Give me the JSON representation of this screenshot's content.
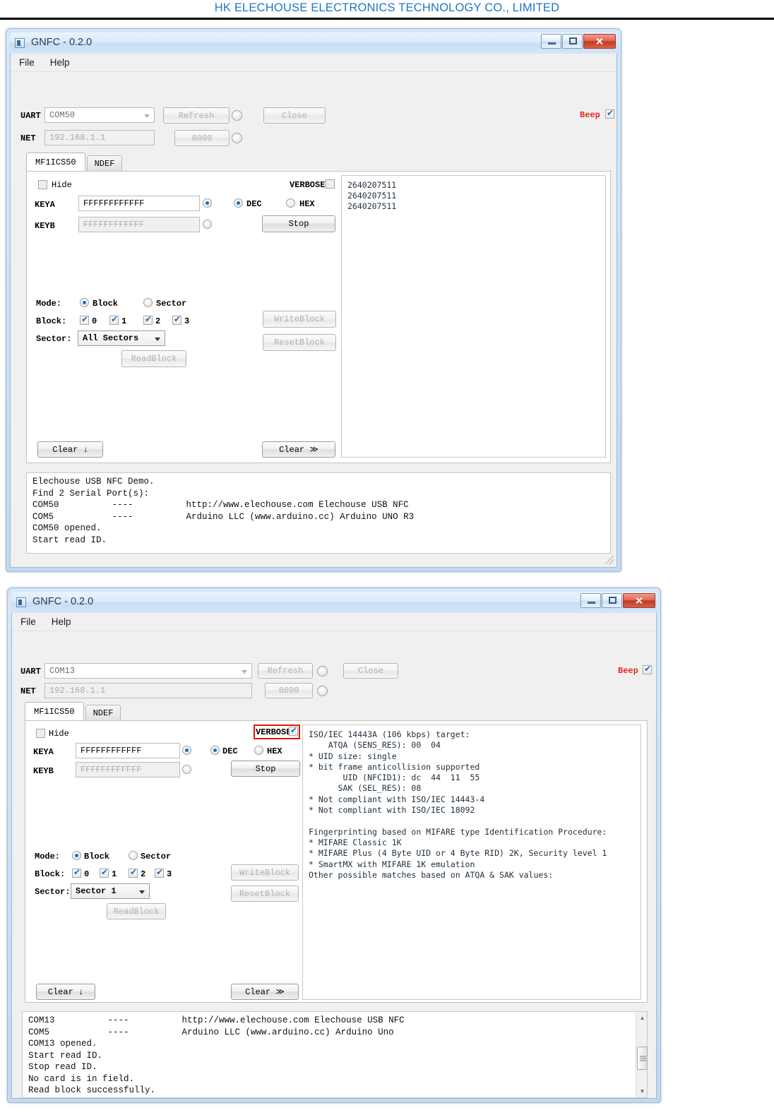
{
  "page": {
    "header": "HK ELECHOUSE ELECTRONICS TECHNOLOGY CO., LIMITED",
    "header_color": "#1f76c4"
  },
  "windows": [
    {
      "title": "GNFC - 0.2.0",
      "title_icon": "app-icon",
      "buttons": {
        "minimize": "–",
        "maximize": "□",
        "close": "✕"
      },
      "menu": [
        "File",
        "Help"
      ],
      "connection": {
        "uart_label": "UART",
        "uart_value": "COM50",
        "refresh_label": "Refresh",
        "close_label": "Close",
        "net_label": "NET",
        "net_value": "192.168.1.1",
        "port_value": "8000",
        "beep_label": "Beep",
        "beep_checked": true,
        "uart_radio_selected": false,
        "net_radio_selected": false
      },
      "tabs": [
        {
          "label": "MF1ICS50",
          "selected": true
        },
        {
          "label": "NDEF",
          "selected": false
        }
      ],
      "keys": {
        "hide_label": "Hide",
        "hide_checked": false,
        "keya_label": "KEYA",
        "keya_value": "FFFFFFFFFFFF",
        "keya_selected": true,
        "keyb_label": "KEYB",
        "keyb_value": "FFFFFFFFFFFF",
        "keyb_selected": false
      },
      "format": {
        "verbose_label": "VERBOSE",
        "verbose_checked": false,
        "dec_label": "DEC",
        "dec_selected": true,
        "hex_label": "HEX",
        "hex_selected": false,
        "stop_label": "Stop"
      },
      "mode": {
        "mode_label": "Mode:",
        "block_radio_label": "Block",
        "block_radio_selected": true,
        "sector_radio_label": "Sector",
        "sector_radio_selected": false,
        "block_label": "Block:",
        "block_checks": [
          {
            "label": "0",
            "checked": true
          },
          {
            "label": "1",
            "checked": true
          },
          {
            "label": "2",
            "checked": true
          },
          {
            "label": "3",
            "checked": true
          }
        ],
        "sector_label": "Sector:",
        "sector_value": "All Sectors",
        "read_block_label": "ReadBlock",
        "write_block_label": "WriteBlock",
        "reset_block_label": "ResetBlock"
      },
      "clear_left_label": "Clear  ↓",
      "clear_right_label": "Clear  ≫",
      "output": "2640207511\n2640207511\n2640207511",
      "log": "Elechouse USB NFC Demo.\nFind 2 Serial Port(s):\nCOM50          ----          http://www.elechouse.com Elechouse USB NFC\nCOM5           ----          Arduino LLC (www.arduino.cc) Arduino UNO R3\nCOM50 opened.\nStart read ID."
    },
    {
      "title": "GNFC - 0.2.0",
      "title_icon": "app-icon",
      "buttons": {
        "minimize": "–",
        "maximize": "□",
        "close": "✕"
      },
      "menu": [
        "File",
        "Help"
      ],
      "connection": {
        "uart_label": "UART",
        "uart_value": "COM13",
        "refresh_label": "Refresh",
        "close_label": "Close",
        "net_label": "NET",
        "net_value": "192.168.1.1",
        "port_value": "8000",
        "beep_label": "Beep",
        "beep_checked": true,
        "uart_radio_selected": false,
        "net_radio_selected": false
      },
      "tabs": [
        {
          "label": "MF1ICS50",
          "selected": true
        },
        {
          "label": "NDEF",
          "selected": false
        }
      ],
      "keys": {
        "hide_label": "Hide",
        "hide_checked": false,
        "keya_label": "KEYA",
        "keya_value": "FFFFFFFFFFFF",
        "keya_selected": true,
        "keyb_label": "KEYB",
        "keyb_value": "FFFFFFFFFFFF",
        "keyb_selected": false
      },
      "format": {
        "verbose_label": "VERBOSE",
        "verbose_checked": true,
        "verbose_highlighted": true,
        "dec_label": "DEC",
        "dec_selected": true,
        "hex_label": "HEX",
        "hex_selected": false,
        "stop_label": "Stop"
      },
      "mode": {
        "mode_label": "Mode:",
        "block_radio_label": "Block",
        "block_radio_selected": true,
        "sector_radio_label": "Sector",
        "sector_radio_selected": false,
        "block_label": "Block:",
        "block_checks": [
          {
            "label": "0",
            "checked": true
          },
          {
            "label": "1",
            "checked": true
          },
          {
            "label": "2",
            "checked": true
          },
          {
            "label": "3",
            "checked": true
          }
        ],
        "sector_label": "Sector:",
        "sector_value": "Sector 1",
        "read_block_label": "ReadBlock",
        "write_block_label": "WriteBlock",
        "reset_block_label": "ResetBlock"
      },
      "clear_left_label": "Clear ↓",
      "clear_right_label": "Clear ≫",
      "output": "ISO/IEC 14443A (106 kbps) target:\n    ATQA (SENS_RES): 00  04\n* UID size: single\n* bit frame anticollision supported\n       UID (NFCID1): dc  44  11  55\n      SAK (SEL_RES): 08\n* Not compliant with ISO/IEC 14443-4\n* Not compliant with ISO/IEC 18092\n\nFingerprinting based on MIFARE type Identification Procedure:\n* MIFARE Classic 1K\n* MIFARE Plus (4 Byte UID or 4 Byte RID) 2K, Security level 1\n* SmartMX with MIFARE 1K emulation\nOther possible matches based on ATQA & SAK values:",
      "log": "COM13          ----          http://www.elechouse.com Elechouse USB NFC\nCOM5           ----          Arduino LLC (www.arduino.cc) Arduino Uno\nCOM13 opened.\nStart read ID.\nStop read ID.\nNo card is in field.\nRead block successfully.\nStart read ID.",
      "scrollbar": {
        "up": "▲",
        "down": "▼"
      }
    }
  ]
}
